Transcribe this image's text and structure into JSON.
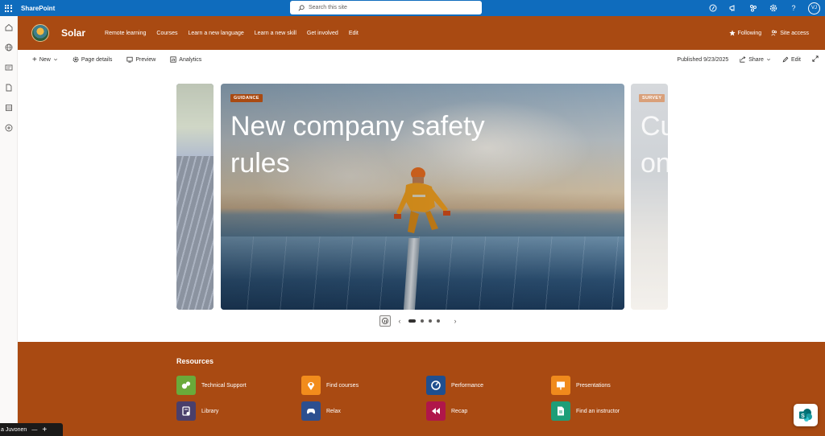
{
  "suitebar": {
    "app_name": "SharePoint",
    "search_placeholder": "Search this site",
    "avatar_initials": "VJ",
    "icons": [
      "waffle-icon",
      "search-icon",
      "feedback-icon",
      "megaphone-icon",
      "share-network-icon",
      "settings-icon",
      "help-icon"
    ]
  },
  "site": {
    "name": "Solar",
    "nav": [
      "Remote learning",
      "Courses",
      "Learn a new language",
      "Learn a new skill",
      "Get involved",
      "Edit"
    ],
    "following_label": "Following",
    "site_access_label": "Site access",
    "brand_color": "#a94a12"
  },
  "commandbar": {
    "new_label": "New",
    "page_details_label": "Page details",
    "preview_label": "Preview",
    "analytics_label": "Analytics",
    "published_label": "Published 9/23/2025",
    "share_label": "Share",
    "edit_label": "Edit"
  },
  "carousel": {
    "slides": [
      {
        "tag": "",
        "title": ""
      },
      {
        "tag": "GUIDANCE",
        "title": "New company safety rules"
      },
      {
        "tag": "SURVEY",
        "title": "Cu on"
      }
    ],
    "main_title_line1": "New company safety",
    "main_title_line2": "rules",
    "right_title_line1": "Cu",
    "right_title_line2": "on",
    "dots": 4,
    "active_dot": 0
  },
  "resources": {
    "title": "Resources",
    "items": [
      {
        "label": "Technical Support",
        "color": "#6aaa3a",
        "icon": "chat-bubbles-icon"
      },
      {
        "label": "Find courses",
        "color": "#f28c1c",
        "icon": "map-pin-icon"
      },
      {
        "label": "Performance",
        "color": "#1f4f8f",
        "icon": "gauge-icon"
      },
      {
        "label": "Presentations",
        "color": "#f08a1c",
        "icon": "presentation-icon"
      },
      {
        "label": "Library",
        "color": "#4a3f6b",
        "icon": "library-icon"
      },
      {
        "label": "Relax",
        "color": "#2c4f8f",
        "icon": "gamepad-icon"
      },
      {
        "label": "Recap",
        "color": "#b0164a",
        "icon": "rewind-icon"
      },
      {
        "label": "Find an instructor",
        "color": "#1e9e78",
        "icon": "document-icon"
      }
    ]
  },
  "user_chip": {
    "name": "a Juvonen"
  }
}
